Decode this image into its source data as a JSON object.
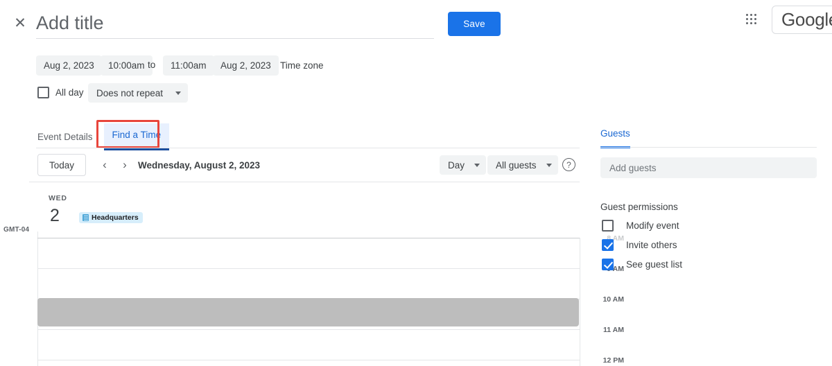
{
  "header": {
    "close_icon": "close-icon",
    "title_value": "",
    "title_placeholder": "Add title",
    "save_label": "Save",
    "apps_icon": "apps-grid-icon",
    "google_label": "Google"
  },
  "when": {
    "start_date": "Aug 2, 2023",
    "start_time": "10:00am",
    "to_label": "to",
    "end_time": "11:00am",
    "end_date": "Aug 2, 2023",
    "timezone_label": "Time zone",
    "all_day_label": "All day",
    "all_day_checked": false,
    "recurrence_value": "Does not repeat"
  },
  "tabs": {
    "items": [
      {
        "label": "Event Details",
        "active": false
      },
      {
        "label": "Find a Time",
        "active": true
      }
    ],
    "annotation_color": "#e8453c"
  },
  "calendar_toolbar": {
    "today_label": "Today",
    "prev_icon": "chevron-left-icon",
    "next_icon": "chevron-right-icon",
    "current_date": "Wednesday, August 2, 2023",
    "view_value": "Day",
    "guest_filter_value": "All guests",
    "help_icon": "help-circle-icon"
  },
  "day_column": {
    "dow": "WED",
    "day_number": "2",
    "room_chip": "Headquarters",
    "room_icon": "building-icon"
  },
  "time_grid": {
    "timezone_label": "GMT-04",
    "hours": [
      "8 AM",
      "9 AM",
      "10 AM",
      "11 AM",
      "12 PM"
    ],
    "busy_block": {
      "start": "10:00am",
      "end": "11:00am",
      "color": "#bdbdbd"
    }
  },
  "guests_panel": {
    "tab_label": "Guests",
    "add_guests_value": "",
    "add_guests_placeholder": "Add guests",
    "permissions_title": "Guest permissions",
    "permissions": [
      {
        "label": "Modify event",
        "checked": false
      },
      {
        "label": "Invite others",
        "checked": true
      },
      {
        "label": "See guest list",
        "checked": true
      }
    ]
  },
  "colors": {
    "accent": "#1a73e8",
    "tab_active_bg": "#e8f0fe",
    "chip_bg": "#f1f3f4",
    "busy": "#bdbdbd",
    "annotation": "#e8453c"
  }
}
